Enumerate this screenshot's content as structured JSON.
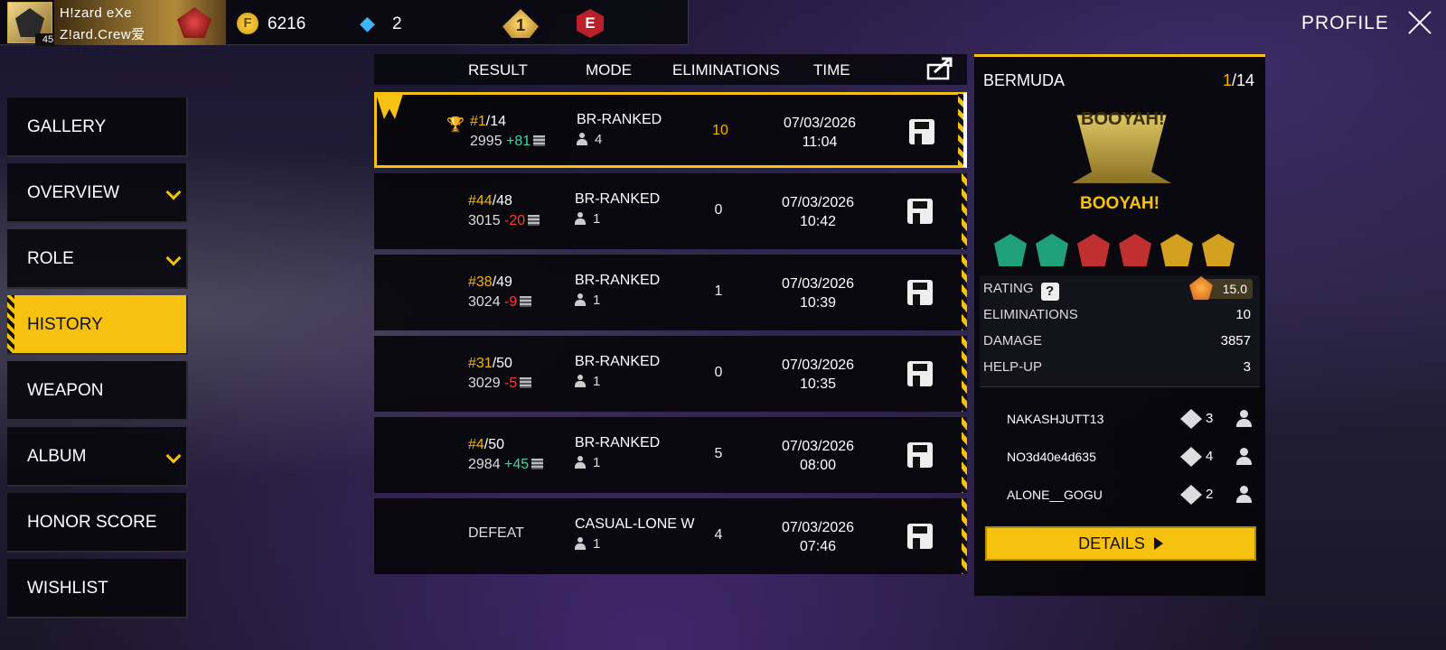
{
  "player": {
    "name_line1": "H!zard     eXe",
    "name_line2": "Z!ard.Crew爱",
    "level": "45"
  },
  "currency": {
    "coin_icon": "gold-coin-icon",
    "coins": "6216",
    "diamond_icon": "diamond-icon",
    "diamonds": "2"
  },
  "badges_top": {
    "rank": "1",
    "e": "E"
  },
  "header": {
    "title": "PROFILE"
  },
  "sidebar": {
    "items": [
      {
        "label": "GALLERY",
        "expandable": false
      },
      {
        "label": "OVERVIEW",
        "expandable": true
      },
      {
        "label": "ROLE",
        "expandable": true
      },
      {
        "label": "HISTORY",
        "expandable": false,
        "active": true
      },
      {
        "label": "WEAPON",
        "expandable": false
      },
      {
        "label": "ALBUM",
        "expandable": true
      },
      {
        "label": "HONOR SCORE",
        "expandable": false
      },
      {
        "label": "WISHLIST",
        "expandable": false
      }
    ]
  },
  "history": {
    "columns": [
      "RESULT",
      "MODE",
      "ELIMINATIONS",
      "TIME"
    ],
    "rows": [
      {
        "position": "#1",
        "total": "/14",
        "points": "2995",
        "delta": "+81",
        "mode": "BR-RANKED",
        "squad": "4",
        "eliminations": "10",
        "date": "07/03/2026",
        "time": "11:04"
      },
      {
        "position": "#44",
        "total": "/48",
        "points": "3015",
        "delta": "-20",
        "mode": "BR-RANKED",
        "squad": "1",
        "eliminations": "0",
        "date": "07/03/2026",
        "time": "10:42"
      },
      {
        "position": "#38",
        "total": "/49",
        "points": "3024",
        "delta": "-9",
        "mode": "BR-RANKED",
        "squad": "1",
        "eliminations": "1",
        "date": "07/03/2026",
        "time": "10:39"
      },
      {
        "position": "#31",
        "total": "/50",
        "points": "3029",
        "delta": "-5",
        "mode": "BR-RANKED",
        "squad": "1",
        "eliminations": "0",
        "date": "07/03/2026",
        "time": "10:35"
      },
      {
        "position": "#4",
        "total": "/50",
        "points": "2984",
        "delta": "+45",
        "mode": "BR-RANKED",
        "squad": "1",
        "eliminations": "5",
        "date": "07/03/2026",
        "time": "08:00"
      },
      {
        "result": "DEFEAT",
        "mode": "CASUAL-LONE W",
        "squad": "1",
        "eliminations": "4",
        "date": "07/03/2026",
        "time": "07:46"
      }
    ]
  },
  "detail": {
    "map": "BERMUDA",
    "placement_rank": "1",
    "placement_total": "/14",
    "emblem_text": "BOOYAH!",
    "result_label": "BOOYAH!",
    "stats": [
      {
        "label": "RATING",
        "value": "15.0"
      },
      {
        "label": "ELIMINATIONS",
        "value": "10"
      },
      {
        "label": "DAMAGE",
        "value": "3857"
      },
      {
        "label": "HELP-UP",
        "value": "3"
      }
    ],
    "teammates": [
      {
        "name": "NAKASHJUTT13",
        "kills": "3"
      },
      {
        "name": "NO3d40e4d635",
        "kills": "4"
      },
      {
        "name": "ALONE__GOGU",
        "kills": "2"
      }
    ],
    "details_button": "DETAILS"
  },
  "colors": {
    "accent": "#f7c20f",
    "gain": "#3fd6a0",
    "loss": "#ff3b2f"
  }
}
